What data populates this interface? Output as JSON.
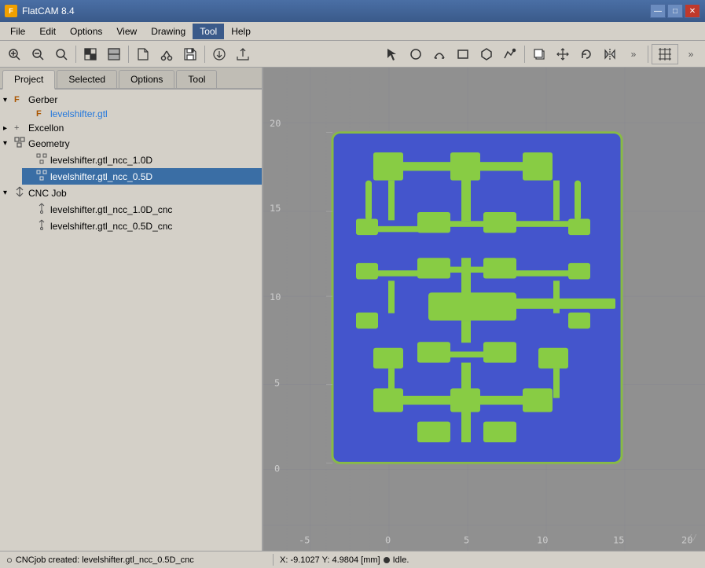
{
  "titleBar": {
    "icon": "F",
    "title": "FlatCAM 8.4",
    "minimizeLabel": "—",
    "maximizeLabel": "□",
    "closeLabel": "✕"
  },
  "menuBar": {
    "items": [
      {
        "label": "File",
        "active": false
      },
      {
        "label": "Edit",
        "active": false
      },
      {
        "label": "Options",
        "active": false
      },
      {
        "label": "View",
        "active": false
      },
      {
        "label": "Drawing",
        "active": false
      },
      {
        "label": "Tool",
        "active": true
      },
      {
        "label": "Help",
        "active": false
      }
    ]
  },
  "toolbar": {
    "buttons": [
      {
        "name": "zoom-fit",
        "icon": "🔍",
        "unicode": "⊕"
      },
      {
        "name": "zoom-in",
        "icon": "🔍",
        "unicode": "⊕"
      },
      {
        "name": "zoom-out",
        "icon": "🔍",
        "unicode": "⊖"
      },
      {
        "name": "sep1",
        "type": "separator"
      },
      {
        "name": "toggle-1",
        "unicode": "▦"
      },
      {
        "name": "toggle-2",
        "unicode": "▤"
      },
      {
        "name": "sep2",
        "type": "separator"
      },
      {
        "name": "new-file",
        "unicode": "📄"
      },
      {
        "name": "open-file",
        "unicode": "✂"
      },
      {
        "name": "save-file",
        "unicode": "💾"
      },
      {
        "name": "sep3",
        "type": "separator"
      },
      {
        "name": "import",
        "unicode": "📋"
      },
      {
        "name": "export",
        "unicode": "📂"
      }
    ],
    "rightButtons": [
      {
        "name": "pointer",
        "unicode": "↖"
      },
      {
        "name": "circle",
        "unicode": "○"
      },
      {
        "name": "arc",
        "unicode": "◡"
      },
      {
        "name": "rect",
        "unicode": "□"
      },
      {
        "name": "polygon",
        "unicode": "⬡"
      },
      {
        "name": "path",
        "unicode": "↗"
      },
      {
        "name": "sep4",
        "type": "separator"
      },
      {
        "name": "copy",
        "unicode": "⧉"
      },
      {
        "name": "move",
        "unicode": "⊞"
      },
      {
        "name": "rotate",
        "unicode": "↻"
      },
      {
        "name": "mirror",
        "unicode": "⊟"
      },
      {
        "name": "more",
        "unicode": "»"
      },
      {
        "name": "grid-toggle",
        "unicode": "⊞"
      },
      {
        "name": "grid-more",
        "unicode": "»"
      }
    ]
  },
  "tabs": [
    {
      "label": "Project",
      "active": true
    },
    {
      "label": "Selected",
      "active": false
    },
    {
      "label": "Options",
      "active": false
    },
    {
      "label": "Tool",
      "active": false
    }
  ],
  "tree": {
    "groups": [
      {
        "name": "Gerber",
        "icon": "F",
        "expanded": true,
        "children": [
          {
            "label": "levelshifter.gtl",
            "icon": "F",
            "color": "#2277dd",
            "selected": false
          }
        ]
      },
      {
        "name": "Excellon",
        "icon": "+",
        "expanded": false,
        "children": []
      },
      {
        "name": "Geometry",
        "icon": "G",
        "expanded": true,
        "children": [
          {
            "label": "levelshifter.gtl_ncc_1.0D",
            "icon": "G",
            "selected": false
          },
          {
            "label": "levelshifter.gtl_ncc_0.5D",
            "icon": "G",
            "selected": true
          }
        ]
      },
      {
        "name": "CNC Job",
        "icon": "C",
        "expanded": true,
        "children": [
          {
            "label": "levelshifter.gtl_ncc_1.0D_cnc",
            "icon": "C",
            "selected": false
          },
          {
            "label": "levelshifter.gtl_ncc_0.5D_cnc",
            "icon": "C",
            "selected": false
          }
        ]
      }
    ]
  },
  "canvas": {
    "yAxisLabels": [
      "20",
      "15",
      "10",
      "5",
      "0"
    ],
    "xAxisLabels": [
      "-5",
      "0",
      "5",
      "10",
      "15",
      "20"
    ]
  },
  "statusBar": {
    "leftText": "CNCjob created: levelshifter.gtl_ncc_0.5D_cnc",
    "leftIcon": "○",
    "coordinates": "X: -9.1027   Y: 4.9804  [mm]",
    "dotColor": "#222",
    "statusText": "Idle."
  }
}
